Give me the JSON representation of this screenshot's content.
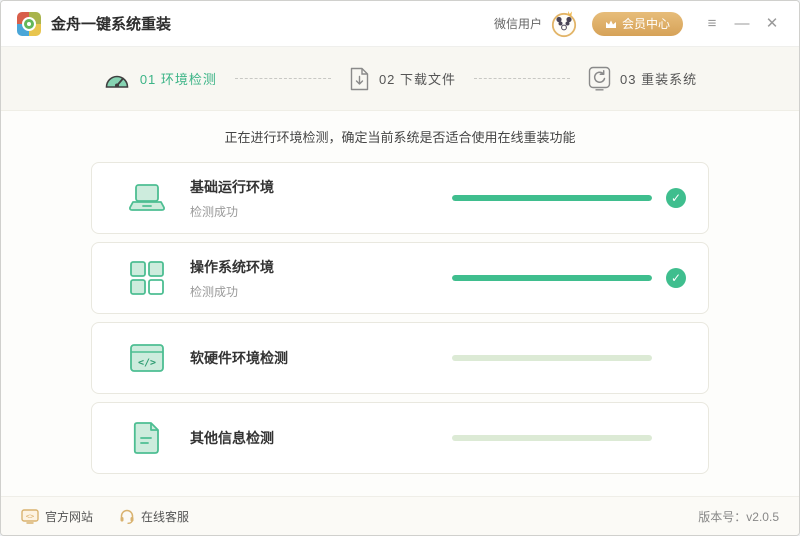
{
  "window": {
    "title": "金舟一键系统重装",
    "user_label": "微信用户",
    "member_button": "会员中心",
    "controls": {
      "menu": "≡",
      "minimize": "—",
      "close": "✕"
    }
  },
  "steps": [
    {
      "number": "01",
      "label": "环境检测",
      "icon": "gauge-icon",
      "active": true
    },
    {
      "number": "02",
      "label": "下载文件",
      "icon": "download-file-icon",
      "active": false
    },
    {
      "number": "03",
      "label": "重装系统",
      "icon": "reinstall-icon",
      "active": false
    }
  ],
  "main": {
    "status_message": "正在进行环境检测，确定当前系统是否适合使用在线重装功能",
    "cards": [
      {
        "title": "基础运行环境",
        "subtitle": "检测成功",
        "icon": "laptop-icon",
        "progress": 100,
        "state": "done"
      },
      {
        "title": "操作系统环境",
        "subtitle": "检测成功",
        "icon": "os-windows-icon",
        "progress": 100,
        "state": "done"
      },
      {
        "title": "软硬件环境检测",
        "subtitle": "",
        "icon": "code-window-icon",
        "progress": 0,
        "state": "pending"
      },
      {
        "title": "其他信息检测",
        "subtitle": "",
        "icon": "document-icon",
        "progress": 0,
        "state": "pending"
      }
    ]
  },
  "footer": {
    "official_site": "官方网站",
    "online_support": "在线客服",
    "version_label": "版本号：v2.0.5"
  },
  "colors": {
    "accent_green": "#3fbe8e",
    "step_active_green": "#3cb487",
    "accent_gold": "#d9a95f",
    "progress_inactive": "#dcead5"
  }
}
